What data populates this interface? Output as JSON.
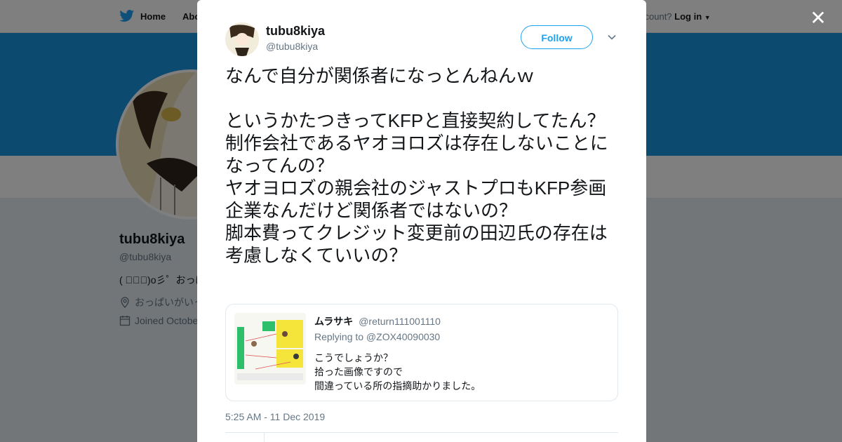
{
  "background": {
    "nav": {
      "home_label": "Home",
      "about_label": "Abo",
      "account_prompt": "ccount?",
      "login_label": "Log in"
    },
    "profile": {
      "name": "tubu8kiya",
      "handle": "@tubu8kiya",
      "bio": "( ﾟ∀ﾟ)o彡゜おっぱ",
      "location": "おっぱいがいっ",
      "joined": "Joined Octobe"
    },
    "colors": {
      "banner": "#1b95e0",
      "overlay": "rgba(0,0,0,0.5)"
    }
  },
  "modal": {
    "author": {
      "name": "tubu8kiya",
      "handle": "@tubu8kiya"
    },
    "follow_label": "Follow",
    "tweet_text": "なんで自分が関係者になっとんねんｗ\n\nというかたつきってKFPと直接契約してたん？\n制作会社であるヤオヨロズは存在しないことになってんの？\nヤオヨロズの親会社のジャストプロもKFP参画企業なんだけど関係者ではないの？\n脚本費ってクレジット変更前の田辺氏の存在は考慮しなくていいの？",
    "quoted": {
      "name": "ムラサキ",
      "handle": "@return111001110",
      "replying_to": "Replying to @ZOX40090030",
      "text": "こうでしょうか？\n拾った画像ですので\n間違っている所の指摘助かりました。"
    },
    "timestamp": "5:25 AM - 11 Dec 2019"
  },
  "icons": {
    "close": "close-icon",
    "caret": "chevron-down-icon",
    "bird": "twitter-bird-icon",
    "location": "location-pin-icon",
    "calendar": "calendar-icon"
  },
  "accent": "#1da1f2"
}
